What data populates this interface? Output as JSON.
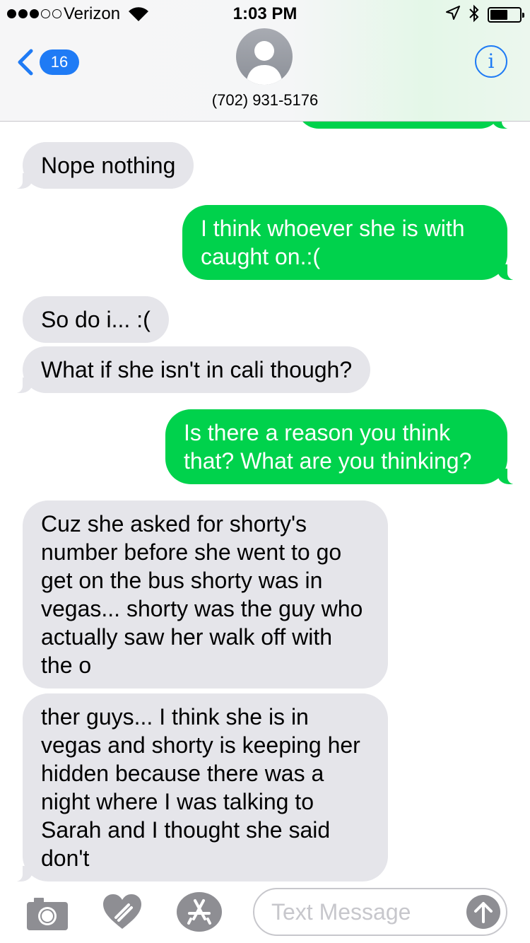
{
  "status_bar": {
    "carrier": "Verizon",
    "time": "1:03 PM",
    "signal_bars_filled": 3,
    "signal_bars_total": 5,
    "battery_level": 0.6
  },
  "header": {
    "back_badge": "16",
    "contact": "(702) 931-5176",
    "info_symbol": "i"
  },
  "messages": [
    {
      "direction": "incoming",
      "text": "Nope nothing"
    },
    {
      "direction": "outgoing",
      "text": "I think whoever she is with caught on.:("
    },
    {
      "direction": "incoming",
      "text": "So do i... :("
    },
    {
      "direction": "incoming",
      "text": "What if she isn't in cali though?"
    },
    {
      "direction": "outgoing",
      "text": "Is there a reason you think that? What are you thinking?"
    },
    {
      "direction": "incoming",
      "text": "Cuz she asked for shorty's number before she went to go get on the bus shorty was in vegas... shorty was the guy who actually saw her walk off with the o"
    },
    {
      "direction": "incoming",
      "text": "ther guys... I think she is in vegas and shorty is keeping her hidden because there was a night where I was talking to Sarah and I thought she said don't"
    }
  ],
  "input": {
    "placeholder": "Text Message"
  },
  "colors": {
    "incoming_bubble": "#e5e5ea",
    "outgoing_bubble": "#00d24c",
    "accent": "#1f7bf5",
    "icon_gray": "#8e8e93"
  },
  "icons": {
    "camera": "camera-icon",
    "heart": "digital-touch-heart-icon",
    "appstore": "app-store-icon",
    "send": "send-arrow-icon",
    "back": "chevron-left-icon",
    "info": "info-icon"
  }
}
